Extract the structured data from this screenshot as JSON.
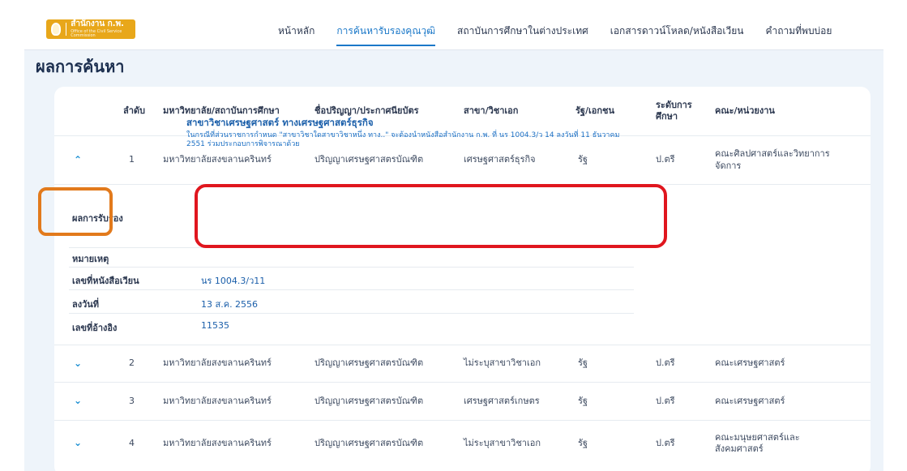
{
  "logo": {
    "main": "สำนักงาน ก.พ.",
    "sub": "Office of the Civil Service Commission"
  },
  "nav": {
    "items": [
      {
        "label": "หน้าหลัก"
      },
      {
        "label": "การค้นหารับรองคุณวุฒิ"
      },
      {
        "label": "สถาบันการศึกษาในต่างประเทศ"
      },
      {
        "label": "เอกสารดาวน์โหลด/หนังสือเวียน"
      },
      {
        "label": "คำถามที่พบบ่อย"
      }
    ],
    "active": "การค้นหารับรองคุณวุฒิ"
  },
  "page_title": "ผลการค้นหา",
  "table": {
    "headers": {
      "no": "ลำดับ",
      "university": "มหาวิทยาลัย/สถาบันการศึกษา",
      "degree": "ชื่อปริญญา/ประกาศนียบัตร",
      "major": "สาขา/วิชาเอก",
      "sector": "รัฐ/เอกชน",
      "level": "ระดับการ ศึกษา",
      "faculty": "คณะ/หน่วยงาน"
    },
    "rows": [
      {
        "no": "1",
        "university": "มหาวิทยาลัยสงขลานครินทร์",
        "degree": "ปริญญาเศรษฐศาสตรบัณฑิต",
        "major": "เศรษฐศาสตร์ธุรกิจ",
        "sector": "รัฐ",
        "level": "ป.ตรี",
        "faculty": "คณะศิลปศาสตร์และวิทยาการจัดการ",
        "expanded": true
      },
      {
        "no": "2",
        "university": "มหาวิทยาลัยสงขลานครินทร์",
        "degree": "ปริญญาเศรษฐศาสตรบัณฑิต",
        "major": "ไม่ระบุสาขาวิชาเอก",
        "sector": "รัฐ",
        "level": "ป.ตรี",
        "faculty": "คณะเศรษฐศาสตร์",
        "expanded": false
      },
      {
        "no": "3",
        "university": "มหาวิทยาลัยสงขลานครินทร์",
        "degree": "ปริญญาเศรษฐศาสตรบัณฑิต",
        "major": "เศรษฐศาสตร์เกษตร",
        "sector": "รัฐ",
        "level": "ป.ตรี",
        "faculty": "คณะเศรษฐศาสตร์",
        "expanded": false
      },
      {
        "no": "4",
        "university": "มหาวิทยาลัยสงขลานครินทร์",
        "degree": "ปริญญาเศรษฐศาสตรบัณฑิต",
        "major": "ไม่ระบุสาขาวิชาเอก",
        "sector": "รัฐ",
        "level": "ป.ตรี",
        "faculty": "คณะมนุษยศาสตร์และสังคมศาสตร์",
        "expanded": false
      }
    ]
  },
  "detail": {
    "certification_label": "ผลการรับรอง",
    "certification_title": "สาขาวิชาเศรษฐศาสตร์ ทางเศรษฐศาสตร์ธุรกิจ",
    "certification_note": "ในกรณีที่ส่วนราชการกำหนด \"สาขาวิชาใดสาขาวิชาหนึ่ง ทาง..\" จะต้องนำหนังสือสำนักงาน ก.พ. ที่ นร 1004.3/ว 14 ลงวันที่ 11 ธันวาคม 2551 ร่วมประกอบการพิจารณาด้วย",
    "remark_label": "หมายเหตุ",
    "remark_value": "",
    "circular_label": "เลขที่หนังสือเวียน",
    "circular_value": "นร 1004.3/ว11",
    "date_label": "ลงวันที่",
    "date_value": "13 ส.ค. 2556",
    "ref_label": "เลขที่อ้างอิง",
    "ref_value": "11535"
  },
  "icons": {
    "expand": "chevron-down-icon",
    "collapse": "chevron-up-icon"
  },
  "colors": {
    "accent": "#1b78c8",
    "orange_highlight": "#e27a1c",
    "red_highlight": "#e0161e",
    "logo_bg": "#e8a71a"
  }
}
